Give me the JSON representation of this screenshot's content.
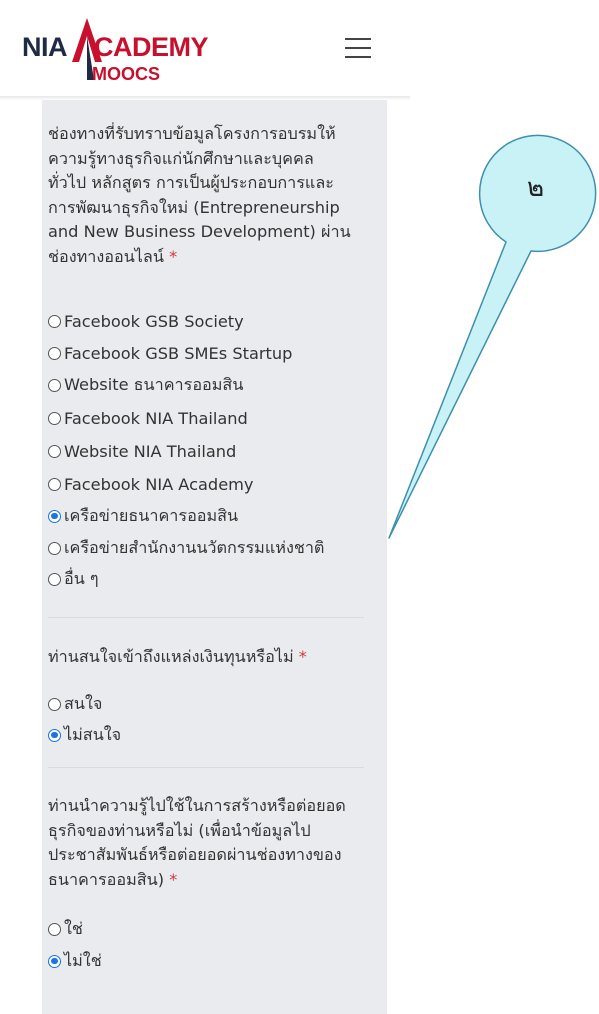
{
  "header": {
    "logo_nia": "NIA",
    "logo_cademy": "CADEMY",
    "logo_moocs": "MOOCS",
    "menu_icon": "hamburger-menu-icon"
  },
  "form": {
    "q1": {
      "text": "ช่องทางที่รับทราบข้อมูลโครงการอบรมให้ความรู้ทางธุรกิจแก่นักศึกษาและบุคคลทั่วไป หลักสูตร การเป็นผู้ประกอบการและการพัฒนาธุรกิจใหม่ (Entrepreneurship and New Business Development) ผ่านช่องทางออนไลน์",
      "lines": [
        "ช่องทางที่รับทราบข้อมูลโครงการอบรมให้",
        "ความรู้ทางธุรกิจแก่นักศึกษาและบุคคล",
        "ทั่วไป หลักสูตร การเป็นผู้ประกอบการและ",
        "การพัฒนาธุรกิจใหม่ (Entrepreneurship",
        "and New Business Development) ผ่าน",
        "ช่องทางออนไลน์"
      ],
      "required_mark": "*",
      "options": [
        "Facebook GSB Society",
        "Facebook GSB SMEs Startup",
        "Website ธนาคารออมสิน",
        "Facebook NIA Thailand",
        "Website NIA Thailand",
        "Facebook NIA Academy",
        "เครือข่ายธนาคารออมสิน",
        "เครือข่ายสำนักงานนวัตกรรมแห่งชาติ",
        "อื่น ๆ"
      ],
      "selected": "เครือข่ายธนาคารออมสิน"
    },
    "q2": {
      "lines": [
        "ท่านสนใจเข้าถึงแหล่งเงินทุนหรือไม่"
      ],
      "required_mark": "*",
      "options": [
        "สนใจ",
        "ไม่สนใจ"
      ],
      "selected": "ไม่สนใจ"
    },
    "q3": {
      "lines": [
        "ท่านนำความรู้ไปใช้ในการสร้างหรือต่อยอด",
        "ธุรกิจของท่านหรือไม่ (เพื่อนำข้อมูลไป",
        "ประชาสัมพันธ์หรือต่อยอดผ่านช่องทางของ",
        "ธนาคารออมสิน)"
      ],
      "required_mark": "*",
      "options": [
        "ใช่",
        "ไม่ใช่"
      ],
      "selected": "ไม่ใช่"
    }
  },
  "callout": {
    "label": "๒",
    "fill": "#c9f2f7",
    "stroke": "#3d8fb0"
  },
  "colors": {
    "accent": "#1a73e8",
    "required": "#d9363e",
    "panel_bg": "#e9ebee",
    "brand_red": "#c8102e",
    "brand_navy": "#1f2a44"
  }
}
